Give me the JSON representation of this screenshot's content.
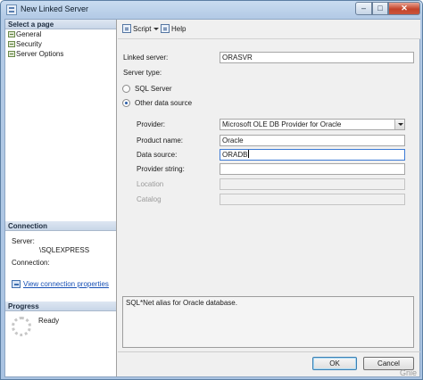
{
  "window": {
    "title": "New Linked Server",
    "minimize": "–",
    "maximize": "□",
    "close": "✕"
  },
  "left_pane": {
    "select_page_header": "Select a page",
    "pages": [
      {
        "label": "General",
        "icon": "page-icon"
      },
      {
        "label": "Security",
        "icon": "page-icon"
      },
      {
        "label": "Server Options",
        "icon": "page-icon"
      }
    ],
    "connection_header": "Connection",
    "server_label": "Server:",
    "server_value": "\\SQLEXPRESS",
    "connection_label": "Connection:",
    "view_connection_properties": "View connection properties",
    "progress_header": "Progress",
    "progress_status": "Ready"
  },
  "toolbar": {
    "script_label": "Script",
    "help_label": "Help"
  },
  "form": {
    "linked_server_label": "Linked server:",
    "linked_server_value": "ORASVR",
    "server_type_label": "Server type:",
    "sql_server_option": "SQL Server",
    "other_source_option": "Other data source",
    "selected_server_type": "Other data source",
    "provider_label": "Provider:",
    "provider_value": "Microsoft OLE DB Provider for Oracle",
    "product_name_label": "Product name:",
    "product_name_value": "Oracle",
    "data_source_label": "Data source:",
    "data_source_value": "ORADB",
    "provider_string_label": "Provider string:",
    "provider_string_value": "",
    "location_label": "Location",
    "location_value": "",
    "catalog_label": "Catalog",
    "catalog_value": ""
  },
  "description": "SQL*Net alias for Oracle database.",
  "buttons": {
    "ok": "OK",
    "cancel": "Cancel"
  },
  "watermark": "Gnie"
}
